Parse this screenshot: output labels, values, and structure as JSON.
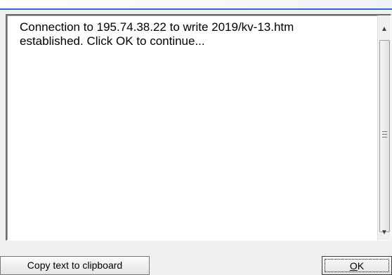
{
  "dialog": {
    "message": "Connection to 195.74.38.22 to write 2019/kv-13.htm\nestablished. Click OK to continue...",
    "copy_button_label": "Copy text to clipboard",
    "ok_button": {
      "mnemonic": "O",
      "rest": "K"
    }
  },
  "scrollbar": {
    "up_arrow": "▲",
    "down_arrow": "▼"
  },
  "icons": {
    "scroll_up": "scroll-up-arrow-icon",
    "scroll_down": "scroll-down-arrow-icon",
    "thumb_grip": "grip-lines-icon"
  }
}
